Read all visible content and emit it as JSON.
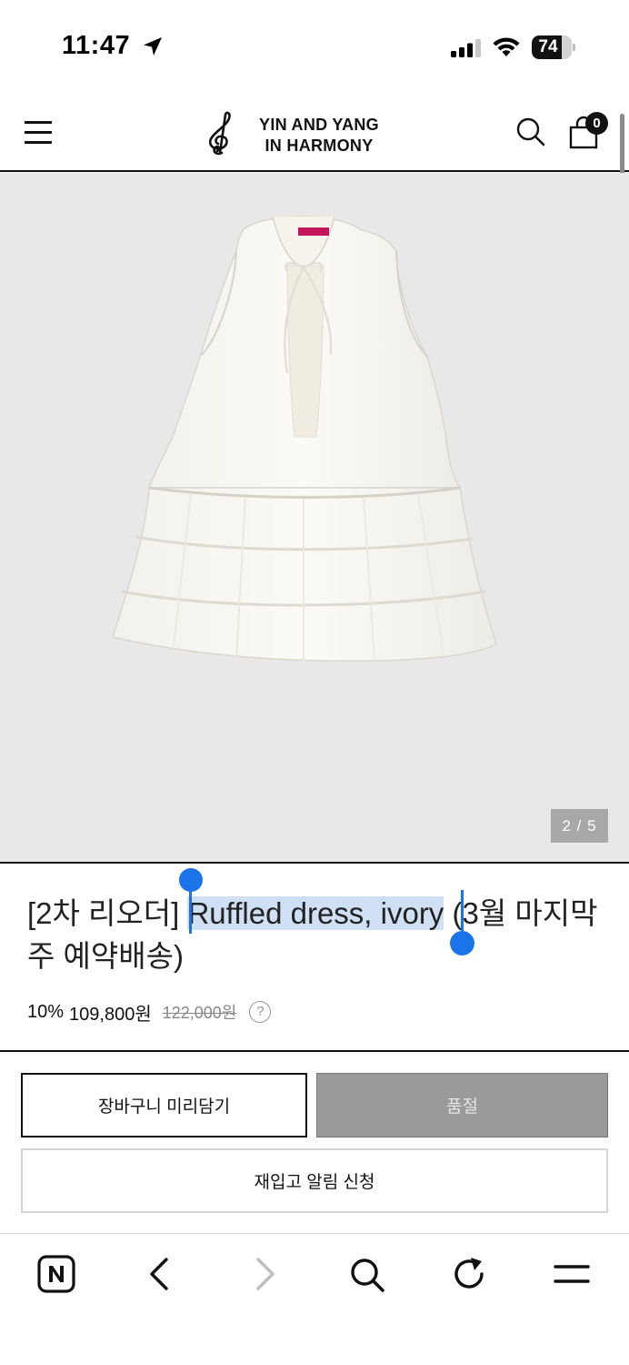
{
  "status_bar": {
    "time": "11:47",
    "battery_level": "74",
    "battery_fraction": 0.74
  },
  "header": {
    "logo_line1": "YIN AND YANG",
    "logo_line2": "IN HARMONY",
    "cart_count": "0"
  },
  "gallery": {
    "counter": "2 / 5"
  },
  "product": {
    "title_before": "[2차 리오더] ",
    "title_selected": "Ruffled dress, ivory",
    "title_after": " (3월 마지막주 예약배송)",
    "discount": "10%",
    "sale_price": "109,800원",
    "original_price": "122,000원",
    "help": "?"
  },
  "actions": {
    "cart_label": "장바구니 미리담기",
    "soldout_label": "품절",
    "restock_label": "재입고 알림 신청"
  },
  "browser_bar": {
    "icons": [
      "naver-icon",
      "back-icon",
      "forward-icon",
      "search-icon",
      "reload-icon",
      "menu-icon"
    ]
  }
}
